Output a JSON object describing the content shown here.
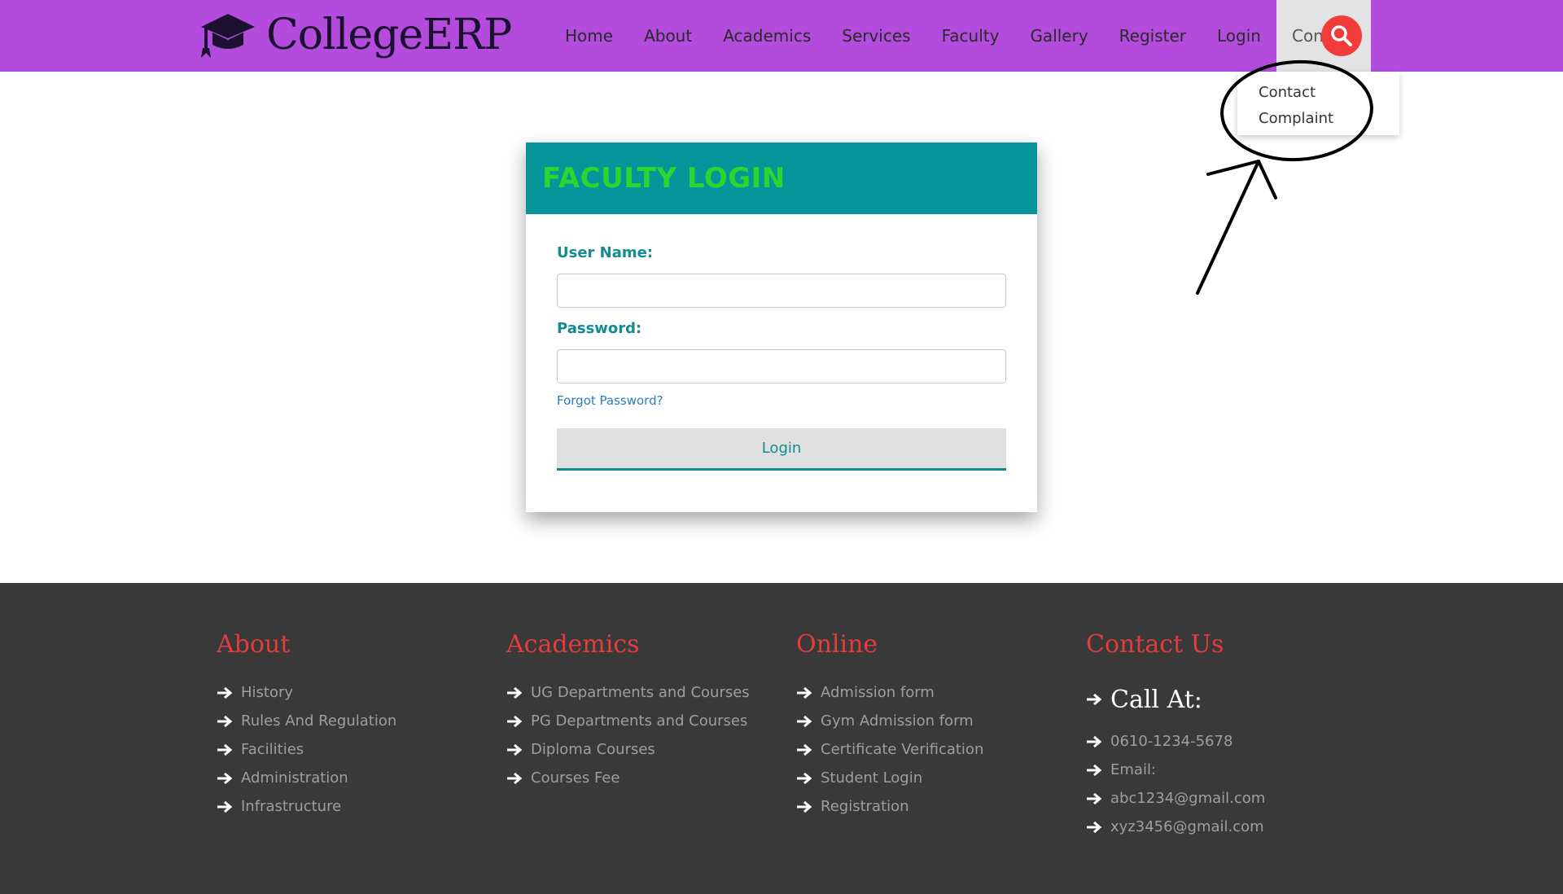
{
  "header": {
    "brand": "CollegeERP",
    "nav": [
      "Home",
      "About",
      "Academics",
      "Services",
      "Faculty",
      "Gallery",
      "Register",
      "Login",
      "Contact"
    ],
    "active_nav": "Contact",
    "dropdown": [
      "Contact",
      "Complaint"
    ]
  },
  "login": {
    "title": "FACULTY LOGIN",
    "username_label": "User Name:",
    "username_value": "",
    "password_label": "Password:",
    "password_value": "",
    "forgot": "Forgot Password?",
    "button": "Login"
  },
  "footer": {
    "about": {
      "title": "About",
      "links": [
        "History",
        "Rules And Regulation",
        "Facilities",
        "Administration",
        "Infrastructure"
      ]
    },
    "academics": {
      "title": "Academics",
      "links": [
        "UG Departments and Courses",
        "PG Departments and Courses",
        "Diploma Courses",
        "Courses Fee"
      ]
    },
    "online": {
      "title": "Online",
      "links": [
        "Admission form",
        "Gym Admission form",
        "Certificate Verification",
        "Student Login",
        "Registration"
      ]
    },
    "contact": {
      "title": "Contact Us",
      "call": "Call At:",
      "items": [
        "0610-1234-5678",
        "Email:",
        "abc1234@gmail.com",
        "xyz3456@gmail.com"
      ]
    }
  },
  "colors": {
    "header_bg": "#b34bdc",
    "card_header": "#07959b",
    "card_title": "#2bd62f",
    "accent_teal": "#138b90",
    "footer_bg": "#393939",
    "footer_heading": "#e43c3c",
    "search_btn": "#f23b3b"
  },
  "icons": {
    "brand": "graduation-cap-icon",
    "search": "search-icon",
    "list_bullet": "arrow-right-icon"
  }
}
